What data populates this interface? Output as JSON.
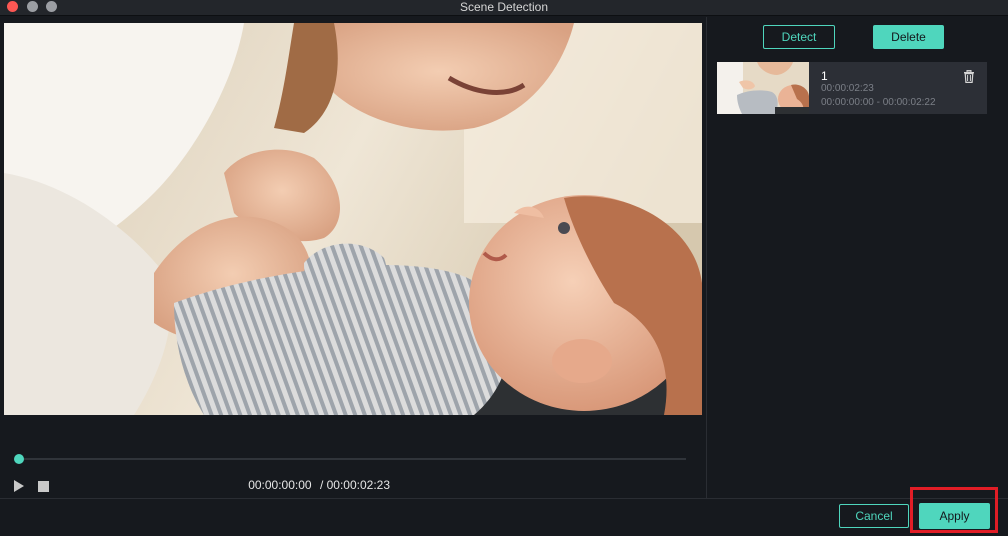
{
  "window": {
    "title": "Scene Detection",
    "controls": [
      "close-icon",
      "minimize-icon",
      "maximize-icon"
    ]
  },
  "player": {
    "current_time": "00:00:00:00",
    "total_time": "/ 00:00:02:23",
    "progress_fraction": 0,
    "controls": [
      "play-icon",
      "stop-icon"
    ]
  },
  "scene_panel": {
    "detect_label": "Detect",
    "delete_label": "Delete",
    "scenes": [
      {
        "index": "1",
        "duration": "00:00:02:23",
        "range": "00:00:00:00 - 00:00:02:22"
      }
    ]
  },
  "footer": {
    "cancel_label": "Cancel",
    "apply_label": "Apply"
  },
  "colors": {
    "accent": "#4fd6bd",
    "background": "#16191e",
    "panel_item": "#2c2f36",
    "highlight": "#e11d26"
  }
}
